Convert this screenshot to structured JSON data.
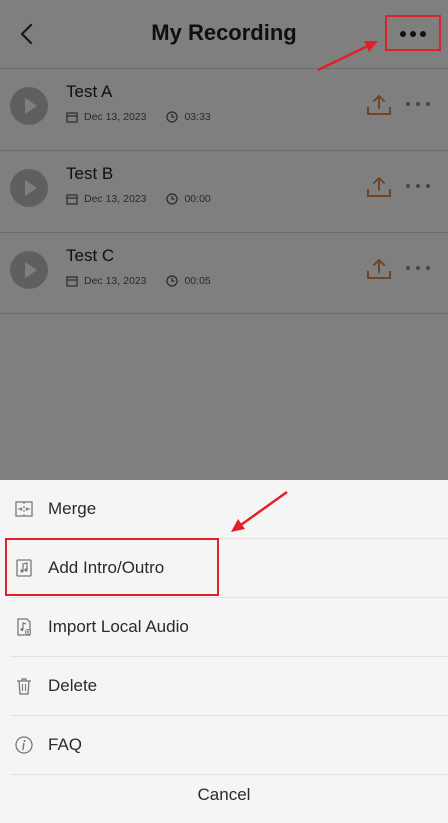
{
  "header": {
    "title": "My Recording"
  },
  "recordings": [
    {
      "name": "Test A",
      "date": "Dec 13, 2023",
      "duration": "03:33"
    },
    {
      "name": "Test B",
      "date": "Dec 13, 2023",
      "duration": "00:00"
    },
    {
      "name": "Test C",
      "date": "Dec 13, 2023",
      "duration": "00:05"
    }
  ],
  "sheet": {
    "items": [
      {
        "label": "Merge",
        "icon": "merge-icon"
      },
      {
        "label": "Add Intro/Outro",
        "icon": "music-file-icon"
      },
      {
        "label": "Import Local Audio",
        "icon": "audio-import-icon"
      },
      {
        "label": "Delete",
        "icon": "trash-icon"
      },
      {
        "label": "FAQ",
        "icon": "info-icon"
      }
    ],
    "cancel_label": "Cancel"
  },
  "colors": {
    "accent": "#e08a4e",
    "annotation": "#e0202a"
  }
}
